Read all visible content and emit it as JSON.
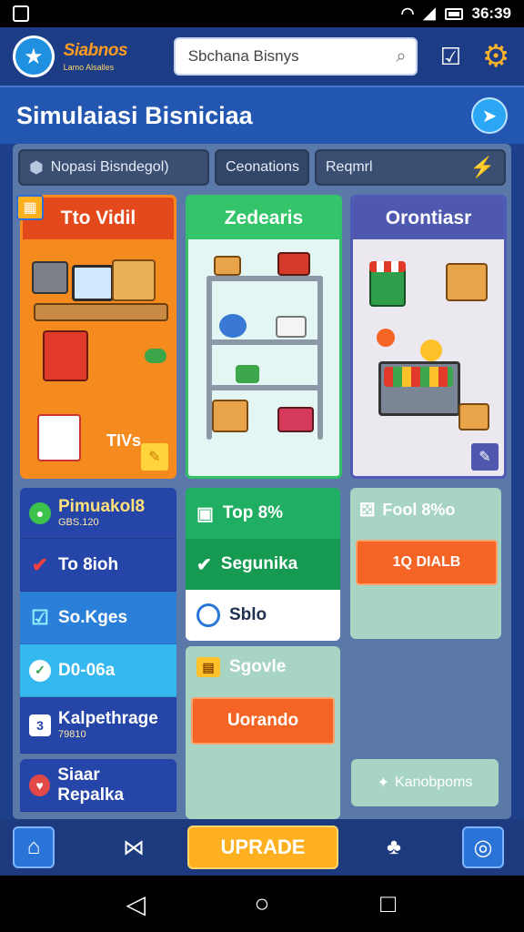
{
  "status_bar": {
    "time": "36:39"
  },
  "app_bar": {
    "brand_name": "Siabnos",
    "brand_subtitle": "Lamo Alsalles",
    "search_placeholder": "Sbchana Bisnys"
  },
  "title_row": {
    "title": "Simulaiasi Bisniciaa"
  },
  "tabs": [
    {
      "label": "Nopasi Bisndegol)"
    },
    {
      "label": "Ceonations"
    },
    {
      "label": "Reqmrl"
    }
  ],
  "cards": [
    {
      "title": "Tto Vidil",
      "foot_text": "TIVs",
      "color": "#e3491a"
    },
    {
      "title": "Zedearis",
      "color": "#34c46a"
    },
    {
      "title": "Orontiasr",
      "color": "#4d58ae"
    }
  ],
  "left_list": [
    {
      "label": "Pimuakol8",
      "sub": "GBS.120"
    },
    {
      "label": "To 8ioh"
    },
    {
      "label": "So.Kges"
    },
    {
      "label": "D0-06a"
    },
    {
      "label": "Kalpethrage",
      "sub": "79810"
    },
    {
      "label": "Siaar Repalka"
    }
  ],
  "middle_list": [
    {
      "label": "Top 8%"
    },
    {
      "label": "Segunika"
    },
    {
      "label": "Sblo"
    }
  ],
  "middle_card": {
    "title": "Sgovle",
    "button": "Uorando"
  },
  "right_card": {
    "title": "Fool 8%o",
    "button": "1Q DIALB"
  },
  "right_pill": {
    "label": "Kanobpoms"
  },
  "bottom_nav": {
    "upgrade_label": "UPRADE"
  },
  "colors": {
    "accent_orange": "#f46424",
    "upgrade_yellow": "#ffb021",
    "header_blue": "#1c3c86"
  }
}
